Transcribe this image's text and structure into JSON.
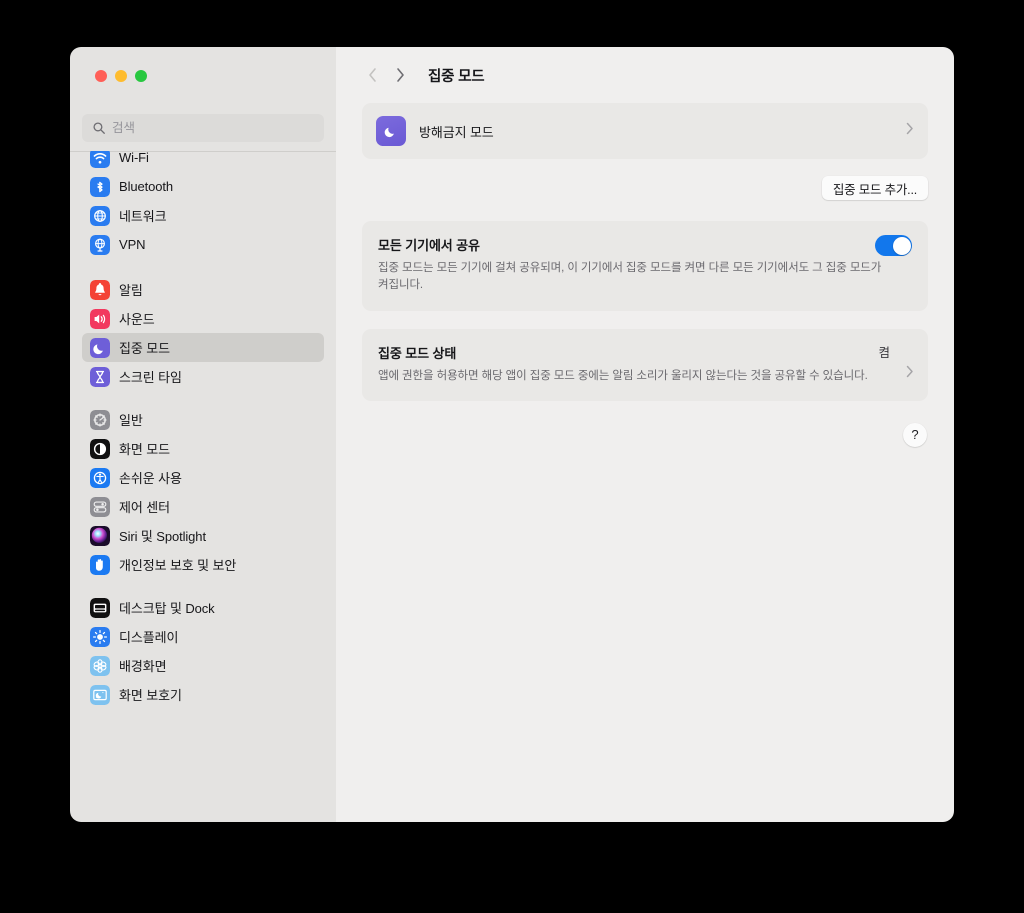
{
  "window": {
    "traffic_lights": [
      {
        "name": "close",
        "color": "#ff5f57"
      },
      {
        "name": "minimize",
        "color": "#febc2e"
      },
      {
        "name": "maximize",
        "color": "#28c840"
      }
    ]
  },
  "sidebar": {
    "search": {
      "placeholder": "검색",
      "value": "",
      "icon": "search-icon"
    },
    "groups": [
      {
        "items": [
          {
            "label": "Wi-Fi",
            "icon": "wifi-icon",
            "selected": false
          },
          {
            "label": "Bluetooth",
            "icon": "bluetooth-icon",
            "selected": false
          },
          {
            "label": "네트워크",
            "icon": "network-globe-icon",
            "selected": false
          },
          {
            "label": "VPN",
            "icon": "vpn-globe-icon",
            "selected": false
          }
        ]
      },
      {
        "items": [
          {
            "label": "알림",
            "icon": "bell-icon",
            "selected": false
          },
          {
            "label": "사운드",
            "icon": "speaker-icon",
            "selected": false
          },
          {
            "label": "집중 모드",
            "icon": "moon-icon",
            "selected": true
          },
          {
            "label": "스크린 타임",
            "icon": "hourglass-icon",
            "selected": false
          }
        ]
      },
      {
        "items": [
          {
            "label": "일반",
            "icon": "gear-icon",
            "selected": false
          },
          {
            "label": "화면 모드",
            "icon": "appearance-icon",
            "selected": false
          },
          {
            "label": "손쉬운 사용",
            "icon": "accessibility-icon",
            "selected": false
          },
          {
            "label": "제어 센터",
            "icon": "control-center-icon",
            "selected": false
          },
          {
            "label": "Siri 및 Spotlight",
            "icon": "siri-icon",
            "selected": false
          },
          {
            "label": "개인정보 보호 및 보안",
            "icon": "privacy-hand-icon",
            "selected": false
          }
        ]
      },
      {
        "items": [
          {
            "label": "데스크탑 및 Dock",
            "icon": "desktop-dock-icon",
            "selected": false
          },
          {
            "label": "디스플레이",
            "icon": "display-brightness-icon",
            "selected": false
          },
          {
            "label": "배경화면",
            "icon": "wallpaper-icon",
            "selected": false
          },
          {
            "label": "화면 보호기",
            "icon": "screensaver-icon",
            "selected": false
          }
        ]
      }
    ]
  },
  "toolbar": {
    "back_icon": "chevron-left-icon",
    "forward_icon": "chevron-right-icon",
    "title": "집중 모드"
  },
  "main": {
    "focus_modes": [
      {
        "label": "방해금지 모드",
        "icon": "moon-icon",
        "chevron": "chevron-right-icon"
      }
    ],
    "add_button_label": "집중 모드 추가...",
    "share_section": {
      "title": "모든 기기에서 공유",
      "description": "집중 모드는 모든 기기에 걸쳐 공유되며, 이 기기에서 집중 모드를 켜면 다른 모든 기기에서도 그 집중 모드가 켜집니다.",
      "toggle_on": true,
      "toggle_color": "#1277ec"
    },
    "status_section": {
      "title": "집중 모드 상태",
      "value": "켬",
      "description": "앱에 권한을 허용하면 해당 앱이 집중 모드 중에는 알림 소리가 울리지 않는다는 것을 공유할 수 있습니다.",
      "chevron": "chevron-right-icon"
    },
    "help_label": "?"
  }
}
